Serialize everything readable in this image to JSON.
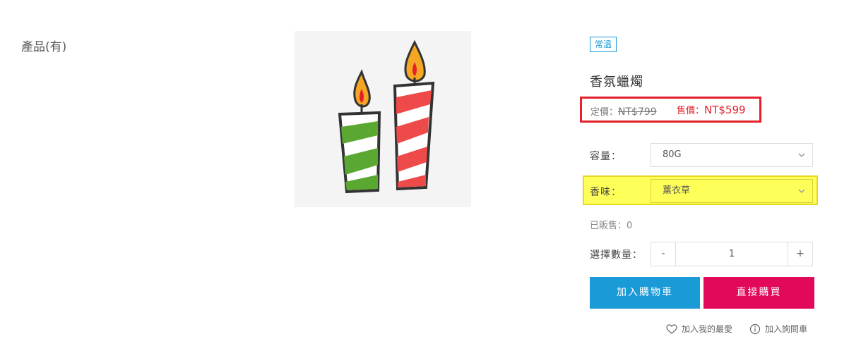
{
  "page": {
    "category_title": "產品(有)"
  },
  "product": {
    "temp_badge": "常溫",
    "name": "香氛蠟燭",
    "list_price_label": "定價：",
    "list_price": "NT$799",
    "sale_price_label": "售價：",
    "sale_price": "NT$599",
    "image_icon": "candles-illustration"
  },
  "options": {
    "capacity_label": "容量：",
    "capacity_value": "80G",
    "scent_label": "香味：",
    "scent_value": "薰衣草"
  },
  "sold": {
    "text": "已販售：0"
  },
  "quantity": {
    "label": "選擇數量：",
    "minus": "-",
    "value": "1",
    "plus": "+"
  },
  "actions": {
    "add_to_cart": "加入購物車",
    "buy_now": "直接購買",
    "add_favorite": "加入我的最愛",
    "add_inquiry": "加入詢問車"
  },
  "colors": {
    "accent_blue": "#1a9ad6",
    "accent_pink": "#e2085a",
    "price_red": "#e5202a",
    "highlight_yellow": "#ffff5a"
  }
}
